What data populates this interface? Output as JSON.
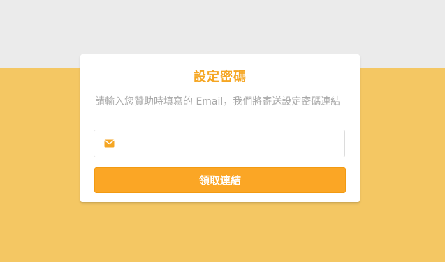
{
  "colors": {
    "page_top_bg": "#ebebeb",
    "page_bottom_bg": "#f4c763",
    "accent": "#f5a623",
    "button_bg": "#fba625",
    "icon_color": "#f5a623"
  },
  "card": {
    "title": "設定密碼",
    "description": "請輸入您贊助時填寫的 Email，我們將寄送設定密碼連結",
    "email_input": {
      "icon": "envelope-icon",
      "value": "",
      "placeholder": ""
    },
    "submit_label": "領取連結"
  }
}
